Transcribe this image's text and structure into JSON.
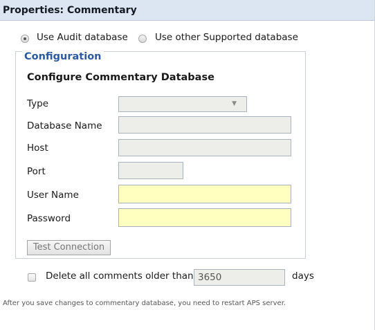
{
  "panel": {
    "title": "Properties: Commentary"
  },
  "source": {
    "option_audit": "Use Audit database",
    "option_other": "Use other Supported database",
    "selected": "option_audit"
  },
  "configuration": {
    "legend": "Configuration",
    "heading": "Configure Commentary Database",
    "fields": {
      "type": {
        "label": "Type",
        "value": ""
      },
      "database_name": {
        "label": "Database Name",
        "value": ""
      },
      "host": {
        "label": "Host",
        "value": ""
      },
      "port": {
        "label": "Port",
        "value": ""
      },
      "user_name": {
        "label": "User Name",
        "value": ""
      },
      "password": {
        "label": "Password",
        "value": ""
      }
    },
    "test_button": "Test Connection"
  },
  "cleanup": {
    "checked": false,
    "label": "Delete all comments older than",
    "days_value": "3650",
    "unit": "days"
  },
  "note": "After you save changes to commentary database, you need to restart APS server.",
  "colors": {
    "titlebar": "#dce6f2",
    "legend": "#2b5aa0",
    "required_field": "#ffffc0",
    "disabled_field": "#ededea"
  },
  "icons": {
    "dropdown": "chevron-down-icon"
  }
}
